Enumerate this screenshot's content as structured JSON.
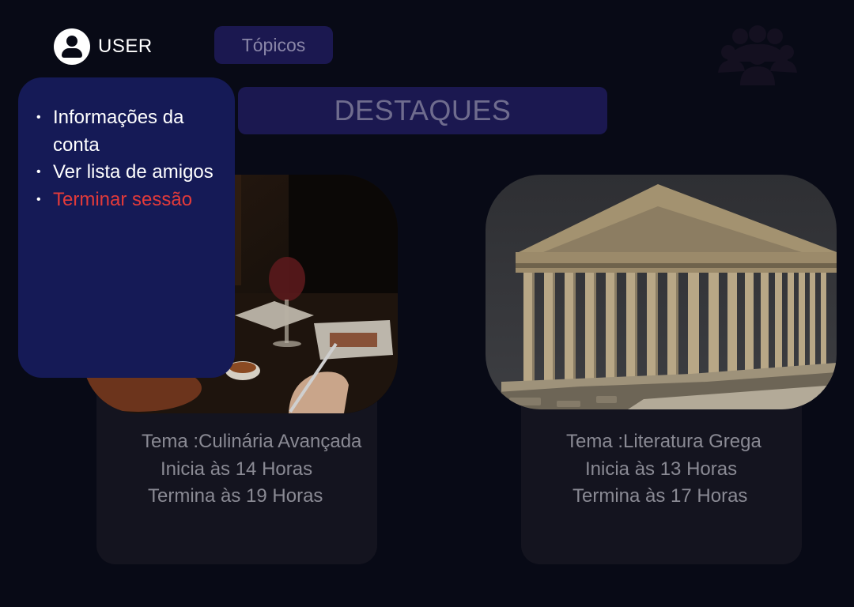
{
  "header": {
    "user_label": "USER",
    "topics_label": "Tópicos",
    "highlights_title": "DESTAQUES"
  },
  "user_menu": {
    "items": [
      {
        "label": "Informações da conta"
      },
      {
        "label": "Ver lista de amigos"
      },
      {
        "label": "Terminar sessão",
        "color": "#e23a3a"
      }
    ]
  },
  "cards": [
    {
      "topic": "Tema :Culinária Avançada",
      "start": "Inicia às 14 Horas",
      "end": "Termina às 19 Horas",
      "image": "dinner-restaurant-photo"
    },
    {
      "topic": "Tema :Literatura Grega",
      "start": "Inicia às 13 Horas",
      "end": "Termina às 17 Horas",
      "image": "parthenon-photo"
    }
  ],
  "colors": {
    "background": "#080a16",
    "menu_background": "#151a56",
    "button_background": "#1b1850",
    "card_background": "#14141f",
    "danger": "#e23a3a"
  }
}
